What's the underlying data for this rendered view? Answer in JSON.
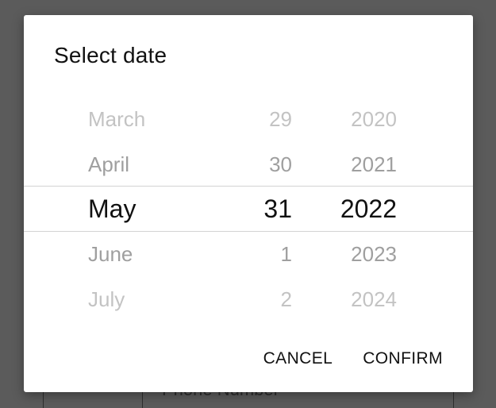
{
  "background": {
    "field_label": "Phone Number"
  },
  "dialog": {
    "title": "Select date",
    "picker": {
      "rows": [
        {
          "month": "March",
          "day": "29",
          "year": "2020"
        },
        {
          "month": "April",
          "day": "30",
          "year": "2021"
        },
        {
          "month": "May",
          "day": "31",
          "year": "2022"
        },
        {
          "month": "June",
          "day": "1",
          "year": "2023"
        },
        {
          "month": "July",
          "day": "2",
          "year": "2024"
        }
      ],
      "selected": {
        "month": "May",
        "day": "31",
        "year": "2022"
      }
    },
    "actions": {
      "cancel_label": "CANCEL",
      "confirm_label": "CONFIRM"
    }
  },
  "colors": {
    "scrim": "#5b5b5b",
    "dialog_bg": "#ffffff",
    "selected_text": "#111111",
    "near_text": "#9f9f9f",
    "far_text": "#c3c3c3",
    "divider": "#d3d3d3"
  }
}
